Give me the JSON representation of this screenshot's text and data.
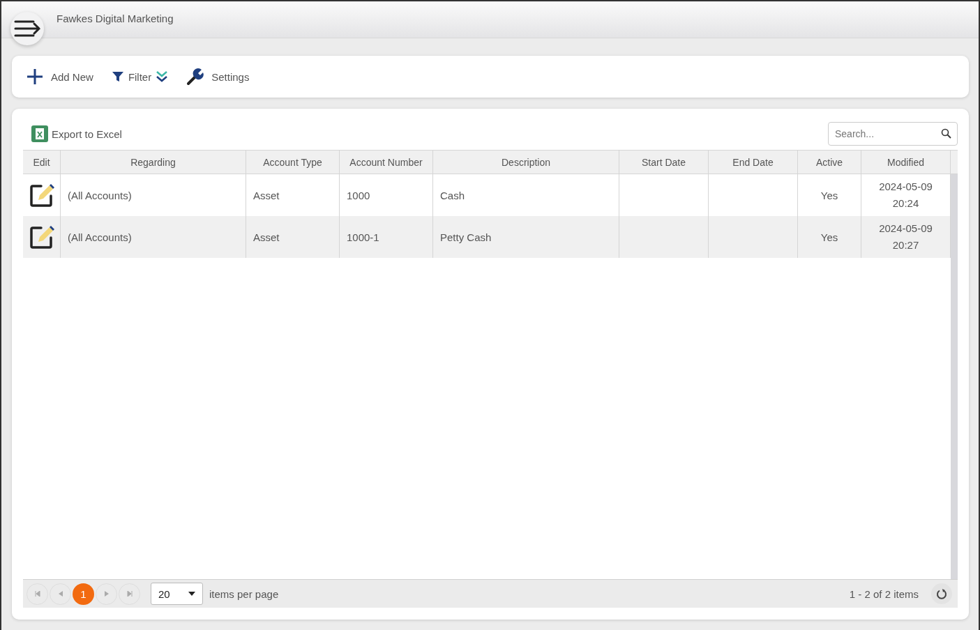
{
  "header": {
    "title": "Fawkes Digital Marketing"
  },
  "toolbar": [
    {
      "kind": "add",
      "label": "Add New"
    },
    {
      "kind": "filter",
      "label": "Filter"
    },
    {
      "kind": "settings",
      "label": "Settings"
    }
  ],
  "export": {
    "label": "Export to Excel"
  },
  "search": {
    "placeholder": "Search..."
  },
  "table": {
    "columns": [
      {
        "label": "Edit"
      },
      {
        "label": "Regarding"
      },
      {
        "label": "Account Type"
      },
      {
        "label": "Account Number"
      },
      {
        "label": "Description"
      },
      {
        "label": "Start Date"
      },
      {
        "label": "End Date"
      },
      {
        "label": "Active"
      },
      {
        "label": "Modified"
      }
    ],
    "rows": [
      {
        "regarding": "(All Accounts)",
        "account_type": "Asset",
        "account_number": "1000",
        "description": "Cash",
        "active": "Yes",
        "modified": [
          "2024-05-09",
          "20:24"
        ]
      },
      {
        "regarding": "(All Accounts)",
        "account_type": "Asset",
        "account_number": "1000-1",
        "description": "Petty Cash",
        "active": "Yes",
        "modified": [
          "2024-05-09",
          "20:27"
        ]
      }
    ]
  },
  "pager": {
    "pages": [
      {
        "label": "1",
        "selected": true
      }
    ],
    "page_size": "20",
    "page_size_label": "items per page",
    "summary": "1 - 2 of 2 items"
  }
}
